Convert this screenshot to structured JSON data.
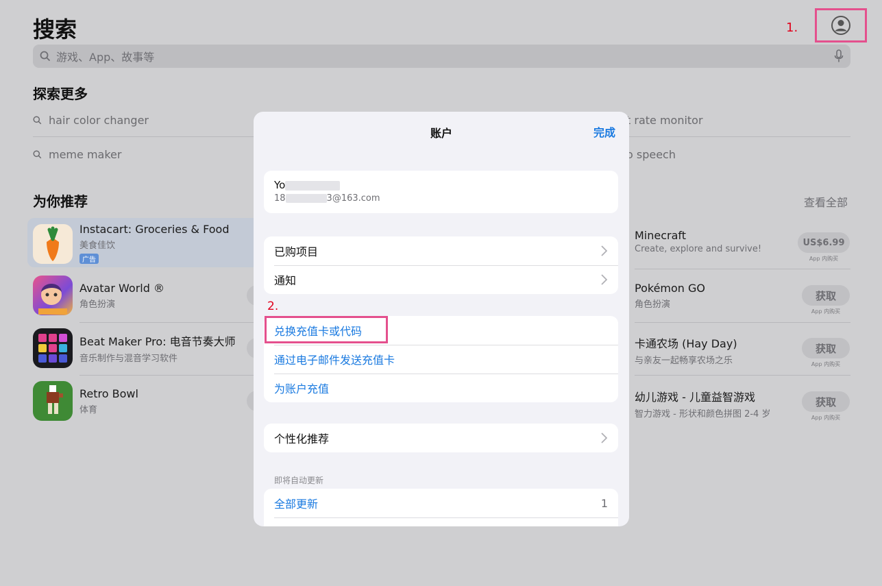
{
  "header": {
    "title": "搜索",
    "annotation_1": "1.",
    "account_icon": "person-circle-icon"
  },
  "search": {
    "placeholder": "游戏、App、故事等"
  },
  "explore": {
    "title": "探索更多",
    "suggestions": [
      "hair color changer",
      "meme maker",
      "t rate monitor",
      "o speech"
    ]
  },
  "recommend": {
    "title": "为你推荐",
    "see_all": "查看全部",
    "left_apps": [
      {
        "name": "Instacart: Groceries & Food",
        "sub": "美食佳饮",
        "badge": "广告"
      },
      {
        "name": "Avatar World ®",
        "sub": "角色扮演"
      },
      {
        "name": "Beat Maker Pro: 电音节奏大师",
        "sub": "音乐制作与混音学习软件"
      },
      {
        "name": "Retro Bowl",
        "sub": "体育"
      }
    ],
    "right_apps": [
      {
        "name": "Minecraft",
        "sub": "Create, explore and survive!",
        "button": "US$6.99",
        "iap": "App 内购买"
      },
      {
        "name": "Pokémon GO",
        "sub": "角色扮演",
        "button": "获取",
        "iap": "App 内购买"
      },
      {
        "name": "卡通农场 (Hay Day)",
        "sub": "与亲友一起畅享农场之乐",
        "button": "获取",
        "iap": "App 内购买"
      },
      {
        "name": "幼儿游戏 - 儿童益智游戏",
        "sub": "智力游戏 - 形状和颜色拼图 2-4 岁",
        "button": "获取",
        "iap": "App 内购买"
      }
    ]
  },
  "modal": {
    "title": "账户",
    "done": "完成",
    "profile": {
      "name_prefix": "Yo",
      "email_prefix": "18",
      "email_suffix": "3@163.com"
    },
    "group1": [
      "已购项目",
      "通知"
    ],
    "annotation_2": "2.",
    "group2": [
      "兑换充值卡或代码",
      "通过电子邮件发送充值卡",
      "为账户充值"
    ],
    "group3": [
      "个性化推荐"
    ],
    "updates_caption": "即将自动更新",
    "update_all": "全部更新",
    "update_count": "1"
  }
}
